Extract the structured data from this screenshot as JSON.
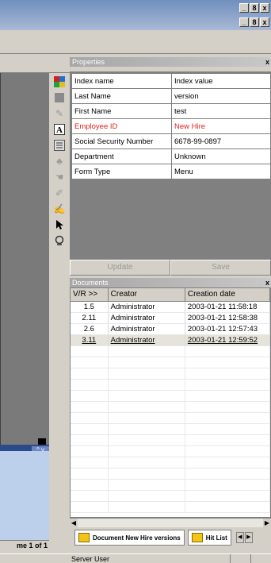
{
  "window": {
    "minimize": "_",
    "restore": "8",
    "close": "x"
  },
  "left": {
    "page_status": "me 1 of 1",
    "scroll_marks": "^ v"
  },
  "tools": [
    "scan-icon",
    "page-icon",
    "pen-icon",
    "text-icon",
    "list-icon",
    "stamp-icon",
    "hand-icon",
    "eraser-icon",
    "highlight-icon",
    "pointer-icon",
    "zoom-icon"
  ],
  "properties": {
    "title": "Properties",
    "close": "x",
    "rows": [
      {
        "key": "Index name",
        "value": "Index value",
        "highlight": false
      },
      {
        "key": "Last Name",
        "value": "version",
        "highlight": false
      },
      {
        "key": "First Name",
        "value": "test",
        "highlight": false
      },
      {
        "key": "Employee ID",
        "value": "New Hire",
        "highlight": true
      },
      {
        "key": "Social Security Number",
        "value": "6678-99-0897",
        "highlight": false
      },
      {
        "key": "Department",
        "value": "Unknown",
        "highlight": false
      },
      {
        "key": "Form Type",
        "value": "Menu",
        "highlight": false
      }
    ],
    "update_label": "Update",
    "save_label": "Save"
  },
  "documents": {
    "title": "Documents",
    "close": "x",
    "columns": [
      "V/R >>",
      "Creator",
      "Creation date"
    ],
    "rows": [
      {
        "vr": "1.5",
        "creator": "Administrator",
        "date": "2003-01-21 11:58:18",
        "selected": false
      },
      {
        "vr": "2.11",
        "creator": "Administrator",
        "date": "2003-01-21 12:58:38",
        "selected": false
      },
      {
        "vr": "2.6",
        "creator": "Administrator",
        "date": "2003-01-21 12:57:43",
        "selected": false
      },
      {
        "vr": "3.11",
        "creator": "Administrator",
        "date": "2003-01-21 12:59:52",
        "selected": true
      }
    ]
  },
  "tabs": [
    {
      "label": "Document New Hire versions"
    },
    {
      "label": "Hit List"
    }
  ],
  "status": {
    "text": "Server User"
  }
}
